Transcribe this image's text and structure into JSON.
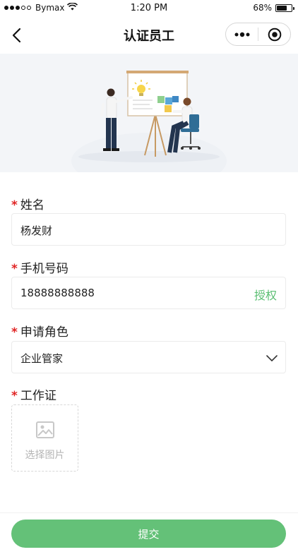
{
  "status_bar": {
    "carrier": "Bymax",
    "time": "1:20 PM",
    "battery": "68%",
    "battery_level": 0.68
  },
  "nav": {
    "title": "认证员工",
    "back_icon": "chevron-left-icon",
    "more_icon": "more-dots-icon",
    "close_icon": "target-circle-icon"
  },
  "banner": {
    "illustration": "team-meeting-illustration"
  },
  "form": {
    "required_mark": "*",
    "name": {
      "label": "姓名",
      "value": "杨发财"
    },
    "phone": {
      "label": "手机号码",
      "value": "18888888888",
      "action": "授权"
    },
    "role": {
      "label": "申请角色",
      "value": "企业管家"
    },
    "work_permit": {
      "label": "工作证",
      "upload_text": "选择图片",
      "upload_icon": "image-icon"
    }
  },
  "submit": {
    "label": "提交"
  },
  "colors": {
    "accent_green": "#64c178",
    "link_green": "#5bbf73",
    "required_red": "#e02424",
    "banner_bg": "#f3f5f8"
  }
}
